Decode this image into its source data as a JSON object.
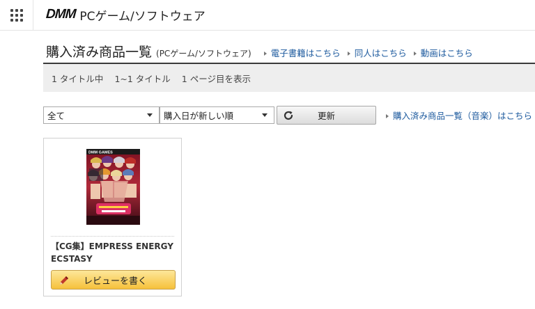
{
  "header": {
    "logo": "DMM",
    "site_title": "PCゲーム/ソフトウェア",
    "menu_icon": "grid-menu-icon"
  },
  "heading": {
    "title": "購入済み商品一覧",
    "subtitle": "(PCゲーム/ソフトウェア)",
    "links": [
      {
        "label": "電子書籍はこちら"
      },
      {
        "label": "同人はこちら"
      },
      {
        "label": "動画はこちら"
      }
    ]
  },
  "summary": {
    "titles_count": "1 タイトル中",
    "range": "1~1 タイトル",
    "page": "1 ページ目を表示"
  },
  "controls": {
    "filter_selected": "全て",
    "sort_selected": "購入日が新しい順",
    "refresh_label": "更新",
    "music_link": "購入済み商品一覧（音楽）はこちら"
  },
  "products": [
    {
      "title": "【CG集】EMPRESS ENERGY ECSTASY",
      "review_label": "レビューを書く",
      "thumbnail_text": "DMM GAMES"
    }
  ],
  "colors": {
    "link": "#1d5a9e",
    "review_button": "#f6c13b",
    "summary_bg": "#eeeeee"
  }
}
